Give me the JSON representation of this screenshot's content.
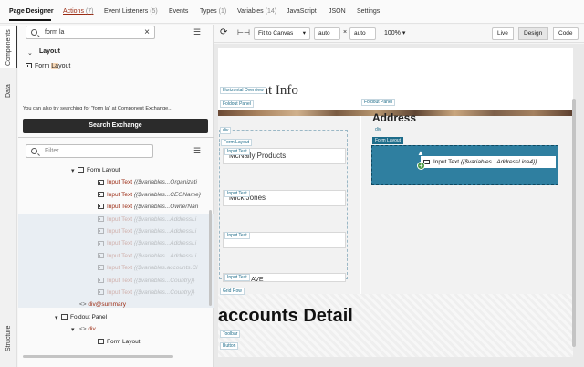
{
  "tabs": {
    "page_designer": "Page Designer",
    "actions": "Actions",
    "actions_count": "(7)",
    "event_listeners": "Event Listeners",
    "event_listeners_count": "(5)",
    "events": "Events",
    "types": "Types",
    "types_count": "(1)",
    "variables": "Variables",
    "variables_count": "(14)",
    "javascript": "JavaScript",
    "json": "JSON",
    "settings": "Settings"
  },
  "rail": {
    "components": "Components",
    "data": "Data",
    "structure": "Structure"
  },
  "components": {
    "search_value": "form la",
    "category": "Layout",
    "item_prefix": "Form ",
    "item_match": "La",
    "item_suffix": "yout",
    "hint": "You can also try searching for \"form la\" at Component Exchange...",
    "exchange_button": "Search Exchange"
  },
  "structure": {
    "filter_placeholder": "Filter",
    "nodes": [
      {
        "kind": "form",
        "text": "Form Layout",
        "faded": false
      },
      {
        "kind": "input",
        "label": "Input Text",
        "expr": "{{$variables...Organizati",
        "faded": false
      },
      {
        "kind": "input",
        "label": "Input Text",
        "expr": "{{$variables...CEOName}",
        "faded": false
      },
      {
        "kind": "input",
        "label": "Input Text",
        "expr": "{{$variables...OwnerNan",
        "faded": false
      },
      {
        "kind": "input",
        "label": "Input Text",
        "expr": "{{$variables...AddressLi",
        "faded": true
      },
      {
        "kind": "input",
        "label": "Input Text",
        "expr": "{{$variables...AddressLi",
        "faded": true
      },
      {
        "kind": "input",
        "label": "Input Text",
        "expr": "{{$variables...AddressLi",
        "faded": true
      },
      {
        "kind": "input",
        "label": "Input Text",
        "expr": "{{$variables...AddressLi",
        "faded": true
      },
      {
        "kind": "input",
        "label": "Input Text",
        "expr": "{{$variables.accounts.Ci",
        "faded": true
      },
      {
        "kind": "input",
        "label": "Input Text",
        "expr": "{{$variables...Country}}",
        "faded": true
      },
      {
        "kind": "input",
        "label": "Input Text",
        "expr": "{{$variables...Country}}",
        "faded": true
      },
      {
        "kind": "tag",
        "text": "div@summary",
        "faded": false
      },
      {
        "kind": "form",
        "text": "Foldout Panel",
        "faded": false
      },
      {
        "kind": "tag",
        "text": "div",
        "faded": false
      },
      {
        "kind": "form",
        "text": "Form Layout",
        "faded": false
      }
    ]
  },
  "toolbar": {
    "fit": "Fit to Canvas",
    "width": "auto",
    "height": "auto",
    "x": "×",
    "zoom": "100%",
    "live": "Live",
    "design": "Design",
    "code": "Code"
  },
  "canvas": {
    "horizontal_overview": "Horizontal Overview",
    "foldout_panel_left": "Foldout Panel",
    "foldout_panel_right": "Foldout Panel",
    "account_info_fragment": "unt Info",
    "address_heading": "Address",
    "div_left": "div",
    "div_right": "div",
    "form_layout_left": "Form Layout",
    "form_layout_right": "Form Layout",
    "input_text": "Input Text",
    "field1": "McNally Products",
    "field2": "Mick Jones",
    "field4_fragment": "UNION AVE",
    "drop_input_label": "Input Text",
    "drop_expr": "{{$variables...AddressLine4}}",
    "grid_row": "Grid Row",
    "accounts_detail": "accounts Detail",
    "toolbar_lbl": "Toolbar",
    "button_lbl": "Button"
  },
  "colors": {
    "accent": "#1d6c8a",
    "drop_zone": "#2f7fa0",
    "brand_red": "#9b2a12"
  }
}
